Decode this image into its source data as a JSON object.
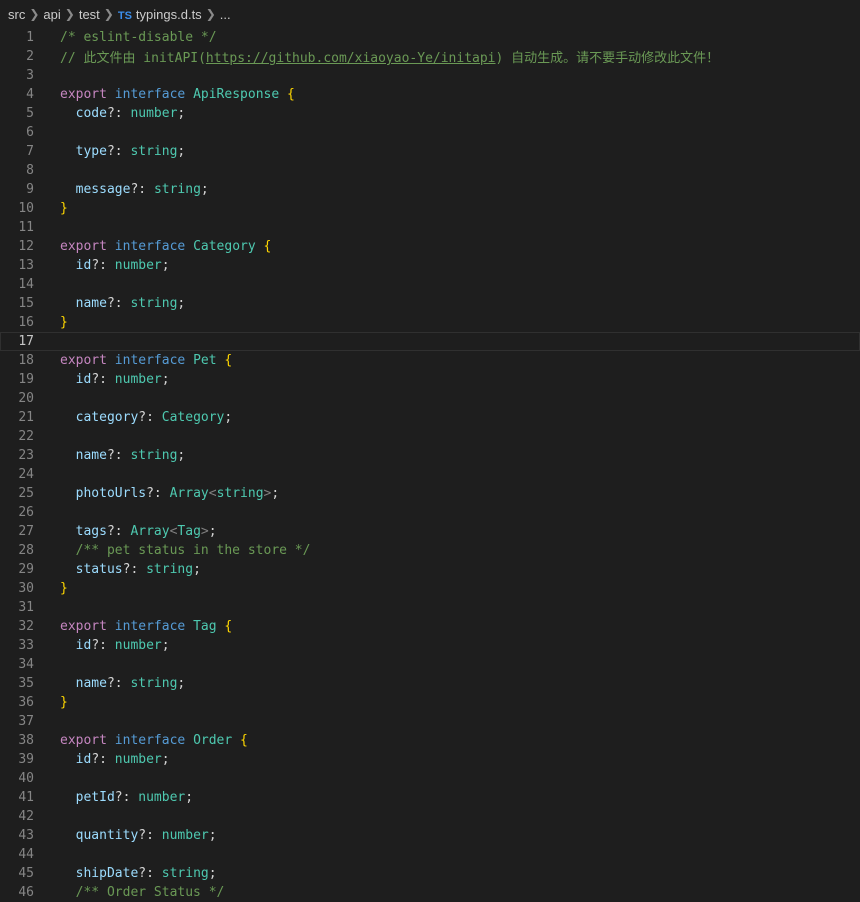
{
  "breadcrumb": {
    "items": [
      "src",
      "api",
      "test"
    ],
    "file_badge": "TS",
    "file": "typings.d.ts",
    "more": "..."
  },
  "editor": {
    "current_line": 17,
    "lines": [
      {
        "n": "1",
        "code": "/* eslint-disable */"
      },
      {
        "n": "2",
        "code": "// 此文件由 initAPI(https://github.com/xiaoyao-Ye/initapi) 自动生成。请不要手动修改此文件！"
      },
      {
        "n": "3",
        "code": ""
      },
      {
        "n": "4",
        "code": "export interface ApiResponse {"
      },
      {
        "n": "5",
        "code": "  code?: number;"
      },
      {
        "n": "6",
        "code": ""
      },
      {
        "n": "7",
        "code": "  type?: string;"
      },
      {
        "n": "8",
        "code": ""
      },
      {
        "n": "9",
        "code": "  message?: string;"
      },
      {
        "n": "10",
        "code": "}"
      },
      {
        "n": "11",
        "code": ""
      },
      {
        "n": "12",
        "code": "export interface Category {"
      },
      {
        "n": "13",
        "code": "  id?: number;"
      },
      {
        "n": "14",
        "code": ""
      },
      {
        "n": "15",
        "code": "  name?: string;"
      },
      {
        "n": "16",
        "code": "}"
      },
      {
        "n": "17",
        "code": ""
      },
      {
        "n": "18",
        "code": "export interface Pet {"
      },
      {
        "n": "19",
        "code": "  id?: number;"
      },
      {
        "n": "20",
        "code": ""
      },
      {
        "n": "21",
        "code": "  category?: Category;"
      },
      {
        "n": "22",
        "code": ""
      },
      {
        "n": "23",
        "code": "  name?: string;"
      },
      {
        "n": "24",
        "code": ""
      },
      {
        "n": "25",
        "code": "  photoUrls?: Array<string>;"
      },
      {
        "n": "26",
        "code": ""
      },
      {
        "n": "27",
        "code": "  tags?: Array<Tag>;"
      },
      {
        "n": "28",
        "code": "  /** pet status in the store */"
      },
      {
        "n": "29",
        "code": "  status?: string;"
      },
      {
        "n": "30",
        "code": "}"
      },
      {
        "n": "31",
        "code": ""
      },
      {
        "n": "32",
        "code": "export interface Tag {"
      },
      {
        "n": "33",
        "code": "  id?: number;"
      },
      {
        "n": "34",
        "code": ""
      },
      {
        "n": "35",
        "code": "  name?: string;"
      },
      {
        "n": "36",
        "code": "}"
      },
      {
        "n": "37",
        "code": ""
      },
      {
        "n": "38",
        "code": "export interface Order {"
      },
      {
        "n": "39",
        "code": "  id?: number;"
      },
      {
        "n": "40",
        "code": ""
      },
      {
        "n": "41",
        "code": "  petId?: number;"
      },
      {
        "n": "42",
        "code": ""
      },
      {
        "n": "43",
        "code": "  quantity?: number;"
      },
      {
        "n": "44",
        "code": ""
      },
      {
        "n": "45",
        "code": "  shipDate?: string;"
      },
      {
        "n": "46",
        "code": "  /** Order Status */"
      }
    ]
  }
}
